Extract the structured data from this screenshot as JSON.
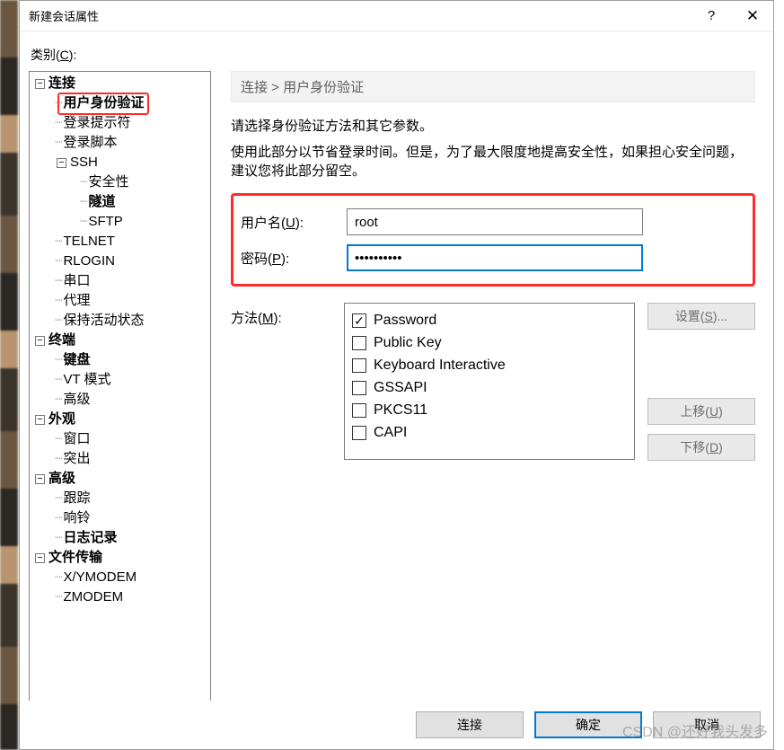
{
  "window": {
    "title": "新建会话属性"
  },
  "category_label_prefix": "类别(",
  "category_label_u": "C",
  "category_label_suffix": "):",
  "tree": {
    "conn": "连接",
    "auth": "用户身份验证",
    "login_prompt": "登录提示符",
    "login_script": "登录脚本",
    "ssh": "SSH",
    "security": "安全性",
    "tunnel": "隧道",
    "sftp": "SFTP",
    "telnet": "TELNET",
    "rlogin": "RLOGIN",
    "serial": "串口",
    "proxy": "代理",
    "keepalive": "保持活动状态",
    "terminal": "终端",
    "keyboard": "键盘",
    "vtmode": "VT 模式",
    "adv1": "高级",
    "appearance": "外观",
    "windowitem": "窗口",
    "highlight": "突出",
    "advanced": "高级",
    "trace": "跟踪",
    "bell": "响铃",
    "logging": "日志记录",
    "filetrans": "文件传输",
    "xymodem": "X/YMODEM",
    "zmodem": "ZMODEM"
  },
  "breadcrumb": "连接 > 用户身份验证",
  "desc1": "请选择身份验证方法和其它参数。",
  "desc2": "使用此部分以节省登录时间。但是，为了最大限度地提高安全性，如果担心安全问题，建议您将此部分留空。",
  "labels": {
    "username_pre": "用户名(",
    "username_u": "U",
    "username_post": "):",
    "password_pre": "密码(",
    "password_u": "P",
    "password_post": "):",
    "method_pre": "方法(",
    "method_u": "M",
    "method_post": "):"
  },
  "fields": {
    "username": "root",
    "password": "••••••••••"
  },
  "methods": [
    {
      "label": "Password",
      "checked": true
    },
    {
      "label": "Public Key",
      "checked": false
    },
    {
      "label": "Keyboard Interactive",
      "checked": false
    },
    {
      "label": "GSSAPI",
      "checked": false
    },
    {
      "label": "PKCS11",
      "checked": false
    },
    {
      "label": "CAPI",
      "checked": false
    }
  ],
  "buttons": {
    "setup_pre": "设置(",
    "setup_u": "S",
    "setup_post": ")...",
    "up_pre": "上移(",
    "up_u": "U",
    "up_post": ")",
    "down_pre": "下移(",
    "down_u": "D",
    "down_post": ")",
    "connect": "连接",
    "ok": "确定",
    "cancel": "取消"
  },
  "watermark": "CSDN @还好我头发多"
}
